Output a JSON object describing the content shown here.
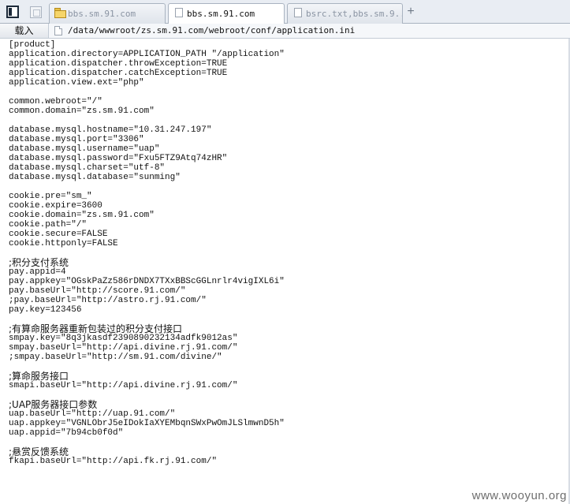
{
  "tabs": [
    {
      "label": "bbs.sm.91.com",
      "icon": "folder-icon",
      "active": false
    },
    {
      "label": "bbs.sm.91.com",
      "icon": "page-icon",
      "active": true
    },
    {
      "label": "bsrc.txt,bbs.sm.9...",
      "icon": "page-icon",
      "active": false
    }
  ],
  "toolbar": {
    "load_label": "载入",
    "url": "/data/wwwroot/zs.sm.91.com/webroot/conf/application.ini"
  },
  "file_lines": [
    "[product]",
    "application.directory=APPLICATION_PATH \"/application\"",
    "application.dispatcher.throwException=TRUE",
    "application.dispatcher.catchException=TRUE",
    "application.view.ext=\"php\"",
    "common.webroot=\"/\"",
    "common.domain=\"zs.sm.91.com\"",
    "database.mysql.hostname=\"10.31.247.197\"",
    "database.mysql.port=\"3306\"",
    "database.mysql.username=\"uap\"",
    "database.mysql.password=\"Fxu5FTZ9Atq74zHR\"",
    "database.mysql.charset=\"utf-8\"",
    "database.mysql.database=\"sunming\"",
    "cookie.pre=\"sm_\"",
    "cookie.expire=3600",
    "cookie.domain=\"zs.sm.91.com\"",
    "cookie.path=\"/\"",
    "cookie.secure=FALSE",
    "cookie.httponly=FALSE",
    ";积分支付系统",
    "pay.appid=4",
    "pay.appkey=\"OGskPaZz586rDNDX7TXxBBScGGLnrlr4vigIXL6i\"",
    "pay.baseUrl=\"http://score.91.com/\"",
    ";pay.baseUrl=\"http://astro.rj.91.com/\"",
    "pay.key=123456",
    ";有算命服务器重新包装过的积分支付接口",
    "smpay.key=\"8q3jkasdf2390890232134adfk9012as\"",
    "smpay.baseUrl=\"http://api.divine.rj.91.com/\"",
    ";smpay.baseUrl=\"http://sm.91.com/divine/\"",
    ";算命服务接口",
    "smapi.baseUrl=\"http://api.divine.rj.91.com/\"",
    ";UAP服务器接口参数",
    "uap.baseUrl=\"http://uap.91.com/\"",
    "uap.appkey=\"VGNLObrJ5eIDokIaXYEMbqnSWxPwOmJLSlmwnD5h\"",
    "uap.appid=\"7b94cb0f0d\"",
    ";悬赏反馈系统",
    "fkapi.baseUrl=\"http://api.fk.rj.91.com/\""
  ],
  "watermark": "www.wooyun.org"
}
